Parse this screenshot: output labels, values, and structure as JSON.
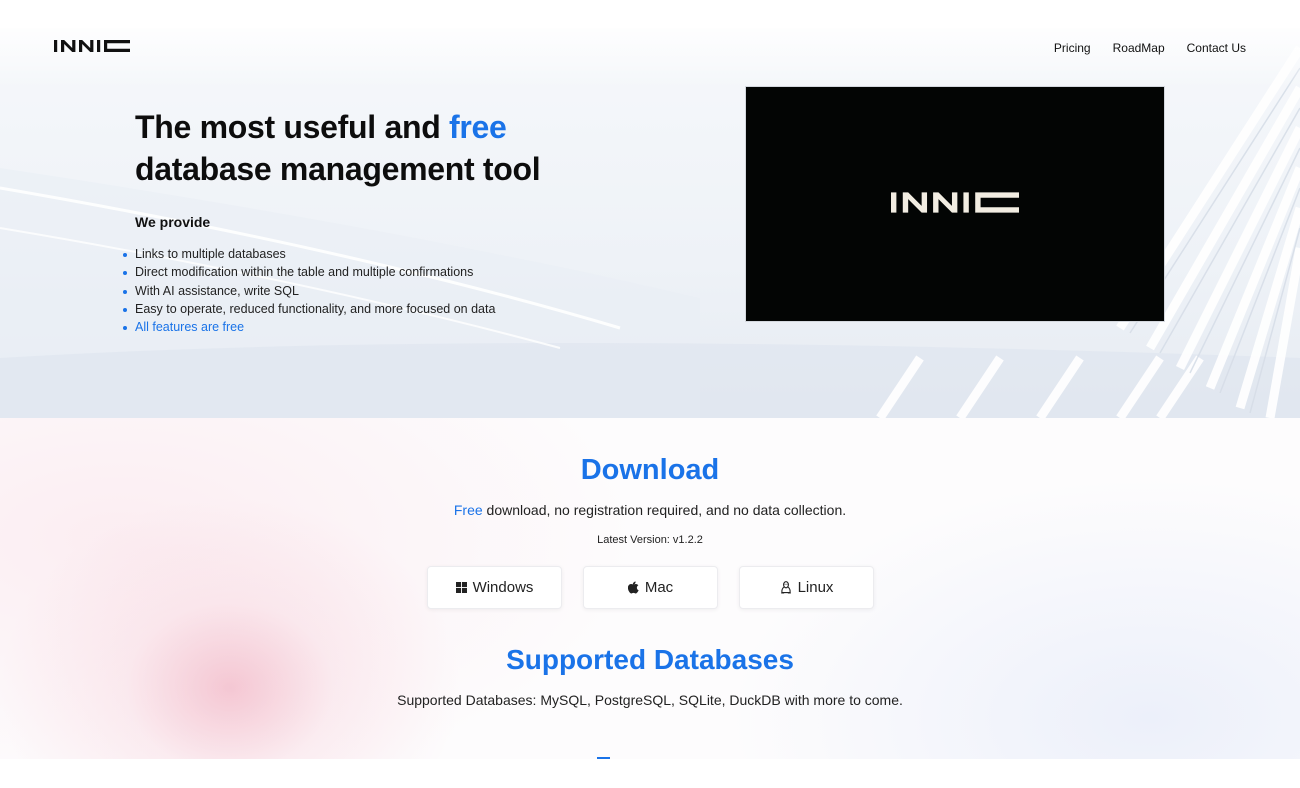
{
  "header": {
    "logo": "INNIC",
    "nav": [
      "Pricing",
      "RoadMap",
      "Contact Us"
    ]
  },
  "hero": {
    "headline_part1": "The most useful and ",
    "headline_accent": "free",
    "headline_part2": "database management tool",
    "provide_label": "We provide",
    "features": [
      "Links to multiple databases",
      "Direct modification within the table and multiple confirmations",
      "With AI assistance, write SQL",
      "Easy to operate, reduced functionality, and more focused on data",
      "All features are free"
    ],
    "video_logo": "INNIC"
  },
  "download": {
    "title": "Download",
    "subtitle_accent": "Free",
    "subtitle_rest": " download, no registration required, and no data collection.",
    "version": "Latest Version: v1.2.2",
    "buttons": [
      {
        "label": "Windows",
        "icon": "windows-icon"
      },
      {
        "label": "Mac",
        "icon": "apple-icon"
      },
      {
        "label": "Linux",
        "icon": "linux-icon"
      }
    ]
  },
  "supported": {
    "title": "Supported Databases",
    "text": "Supported Databases: MySQL, PostgreSQL, SQLite, DuckDB with more to come."
  },
  "colors": {
    "accent": "#1a73e8",
    "video_bg": "#030504",
    "text": "#111111"
  }
}
